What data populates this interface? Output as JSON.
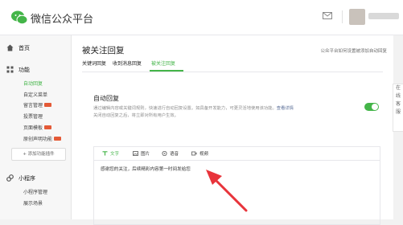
{
  "app": {
    "title": "微信公众平台"
  },
  "header": {
    "mail_icon": "mail-icon",
    "account_name_blurred": true
  },
  "sidebar": {
    "home_label": "首页",
    "function_label": "功能",
    "function_items": [
      {
        "label": "自动回复",
        "active": true,
        "badge": false
      },
      {
        "label": "自定义菜单",
        "active": false,
        "badge": false
      },
      {
        "label": "留言管理",
        "active": false,
        "badge": true
      },
      {
        "label": "投票管理",
        "active": false,
        "badge": false
      },
      {
        "label": "页面模板",
        "active": false,
        "badge": true
      },
      {
        "label": "原创声明功能",
        "active": false,
        "badge": true
      }
    ],
    "add_plugin_label": "+ 添加功能插件",
    "mini_program_label": "小程序",
    "mini_program_items": [
      {
        "label": "小程序管理"
      },
      {
        "label": "展示场景"
      }
    ]
  },
  "main": {
    "page_title": "被关注回复",
    "top_link": "公众平台如何设置被添加自动回复",
    "tabs": [
      {
        "label": "关键词回复",
        "active": false
      },
      {
        "label": "收到消息回复",
        "active": false
      },
      {
        "label": "被关注回复",
        "active": true
      }
    ],
    "section_heading": "自动回复",
    "description_line1": "通过编辑内容或关键词规则，快速进行自动回复设置。如具备开发能力，可更灵活地使用该功能。",
    "description_link": "查看详情",
    "description_line2": "关闭自动回复之后，将立即对所有用户生效。",
    "toggle_on": true,
    "editor": {
      "tools": [
        {
          "label": "文字",
          "icon": "text-icon",
          "active": true
        },
        {
          "label": "图片",
          "icon": "image-icon",
          "active": false
        },
        {
          "label": "语音",
          "icon": "voice-icon",
          "active": false
        },
        {
          "label": "视频",
          "icon": "video-icon",
          "active": false
        }
      ],
      "content": "感谢您的关注，后续精彩内容第一时间发给您"
    }
  },
  "side_panel": {
    "label": "在线客服"
  },
  "colors": {
    "accent": "#44b549",
    "arrow": "#e8343b",
    "badge": "#e45a37"
  }
}
